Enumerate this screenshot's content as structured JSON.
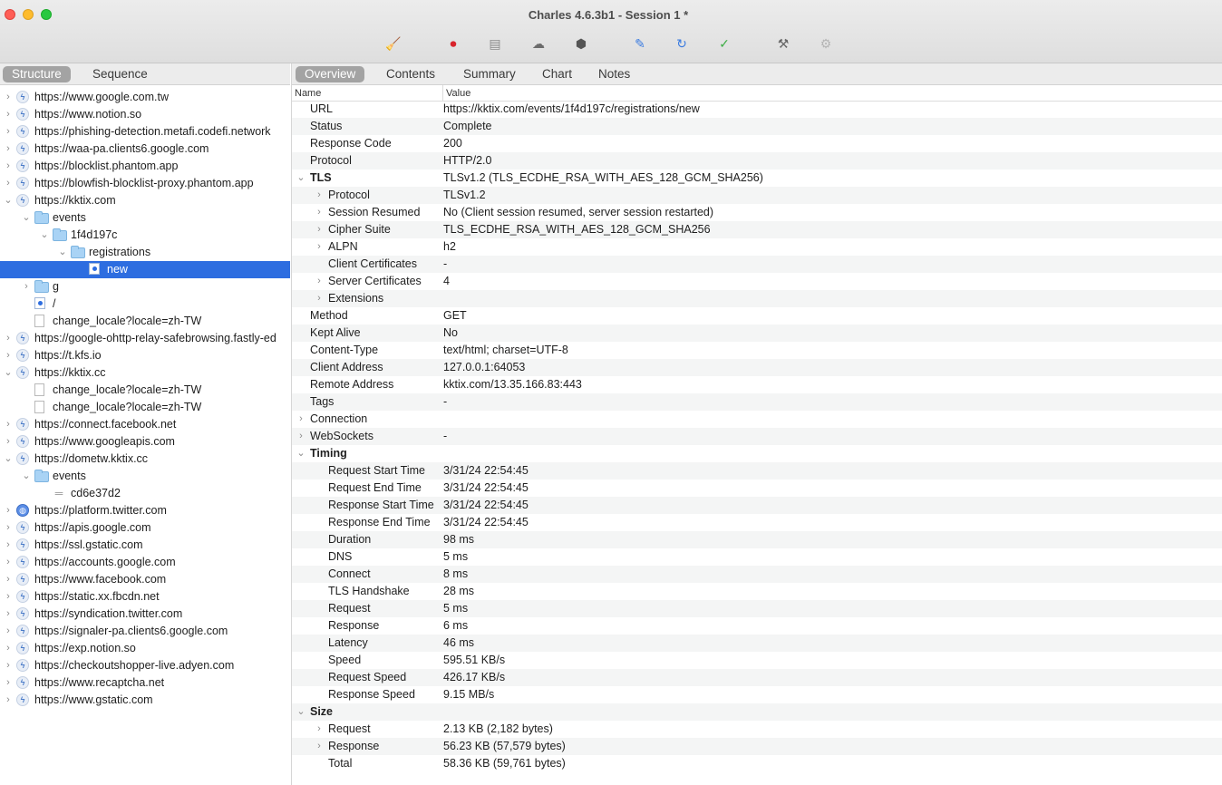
{
  "window": {
    "title": "Charles 4.6.3b1 - Session 1 *"
  },
  "toolbar": [
    {
      "name": "broom-icon",
      "glyph": "🧹"
    },
    {
      "name": "record-icon",
      "glyph": "⏺"
    },
    {
      "name": "throttle-icon",
      "glyph": "▤"
    },
    {
      "name": "cloud-icon",
      "glyph": "☁"
    },
    {
      "name": "stop-icon",
      "glyph": "⬢"
    },
    {
      "name": "pen-icon",
      "glyph": "✎"
    },
    {
      "name": "refresh-icon",
      "glyph": "↻"
    },
    {
      "name": "check-icon",
      "glyph": "✓"
    },
    {
      "name": "tools-icon",
      "glyph": "⚒"
    },
    {
      "name": "settings-icon",
      "glyph": "⚙"
    }
  ],
  "left_tabs": [
    "Structure",
    "Sequence"
  ],
  "right_tabs": [
    "Overview",
    "Contents",
    "Summary",
    "Chart",
    "Notes"
  ],
  "tree": [
    {
      "label": "https://www.google.com.tw",
      "chev": "›",
      "icon": "bolt",
      "indent": 0
    },
    {
      "label": "https://www.notion.so",
      "chev": "›",
      "icon": "bolt",
      "indent": 0
    },
    {
      "label": "https://phishing-detection.metafi.codefi.network",
      "chev": "›",
      "icon": "bolt",
      "indent": 0
    },
    {
      "label": "https://waa-pa.clients6.google.com",
      "chev": "›",
      "icon": "bolt",
      "indent": 0
    },
    {
      "label": "https://blocklist.phantom.app",
      "chev": "›",
      "icon": "bolt",
      "indent": 0
    },
    {
      "label": "https://blowfish-blocklist-proxy.phantom.app",
      "chev": "›",
      "icon": "bolt",
      "indent": 0
    },
    {
      "label": "https://kktix.com",
      "chev": "⌄",
      "icon": "bolt",
      "indent": 0
    },
    {
      "label": "events",
      "chev": "⌄",
      "icon": "folder",
      "indent": 1
    },
    {
      "label": "1f4d197c",
      "chev": "⌄",
      "icon": "folder",
      "indent": 2
    },
    {
      "label": "registrations",
      "chev": "⌄",
      "icon": "folder",
      "indent": 3
    },
    {
      "label": "new",
      "chev": "",
      "icon": "page",
      "indent": 4,
      "selected": true
    },
    {
      "label": "g",
      "chev": "›",
      "icon": "folder",
      "indent": 1
    },
    {
      "label": "/",
      "chev": "",
      "icon": "page",
      "indent": 1
    },
    {
      "label": "change_locale?locale=zh-TW",
      "chev": "",
      "icon": "doc",
      "indent": 1
    },
    {
      "label": "https://google-ohttp-relay-safebrowsing.fastly-ed",
      "chev": "›",
      "icon": "bolt",
      "indent": 0
    },
    {
      "label": "https://t.kfs.io",
      "chev": "›",
      "icon": "bolt",
      "indent": 0
    },
    {
      "label": "https://kktix.cc",
      "chev": "⌄",
      "icon": "bolt",
      "indent": 0
    },
    {
      "label": "change_locale?locale=zh-TW",
      "chev": "",
      "icon": "doc",
      "indent": 1
    },
    {
      "label": "change_locale?locale=zh-TW",
      "chev": "",
      "icon": "doc",
      "indent": 1
    },
    {
      "label": "https://connect.facebook.net",
      "chev": "›",
      "icon": "bolt",
      "indent": 0
    },
    {
      "label": "https://www.googleapis.com",
      "chev": "›",
      "icon": "bolt",
      "indent": 0
    },
    {
      "label": "https://dometw.kktix.cc",
      "chev": "⌄",
      "icon": "bolt",
      "indent": 0
    },
    {
      "label": "events",
      "chev": "⌄",
      "icon": "folder",
      "indent": 1
    },
    {
      "label": "cd6e37d2",
      "chev": "",
      "icon": "eq",
      "indent": 2
    },
    {
      "label": "https://platform.twitter.com",
      "chev": "›",
      "icon": "globe",
      "indent": 0
    },
    {
      "label": "https://apis.google.com",
      "chev": "›",
      "icon": "bolt",
      "indent": 0
    },
    {
      "label": "https://ssl.gstatic.com",
      "chev": "›",
      "icon": "bolt",
      "indent": 0
    },
    {
      "label": "https://accounts.google.com",
      "chev": "›",
      "icon": "bolt",
      "indent": 0
    },
    {
      "label": "https://www.facebook.com",
      "chev": "›",
      "icon": "bolt",
      "indent": 0
    },
    {
      "label": "https://static.xx.fbcdn.net",
      "chev": "›",
      "icon": "bolt",
      "indent": 0
    },
    {
      "label": "https://syndication.twitter.com",
      "chev": "›",
      "icon": "bolt",
      "indent": 0
    },
    {
      "label": "https://signaler-pa.clients6.google.com",
      "chev": "›",
      "icon": "bolt",
      "indent": 0
    },
    {
      "label": "https://exp.notion.so",
      "chev": "›",
      "icon": "bolt",
      "indent": 0
    },
    {
      "label": "https://checkoutshopper-live.adyen.com",
      "chev": "›",
      "icon": "bolt",
      "indent": 0
    },
    {
      "label": "https://www.recaptcha.net",
      "chev": "›",
      "icon": "bolt",
      "indent": 0
    },
    {
      "label": "https://www.gstatic.com",
      "chev": "›",
      "icon": "bolt",
      "indent": 0
    }
  ],
  "overview": {
    "col_name": "Name",
    "col_value": "Value",
    "rows": [
      {
        "name": "URL",
        "value": "https://kktix.com/events/1f4d197c/registrations/new",
        "level": 0,
        "chev": ""
      },
      {
        "name": "Status",
        "value": "Complete",
        "level": 0,
        "chev": ""
      },
      {
        "name": "Response Code",
        "value": "200",
        "level": 0,
        "chev": ""
      },
      {
        "name": "Protocol",
        "value": "HTTP/2.0",
        "level": 0,
        "chev": ""
      },
      {
        "name": "TLS",
        "value": "TLSv1.2 (TLS_ECDHE_RSA_WITH_AES_128_GCM_SHA256)",
        "level": 0,
        "chev": "⌄",
        "bold": true
      },
      {
        "name": "Protocol",
        "value": "TLSv1.2",
        "level": 1,
        "chev": "›"
      },
      {
        "name": "Session Resumed",
        "value": "No (Client session resumed, server session restarted)",
        "level": 1,
        "chev": "›"
      },
      {
        "name": "Cipher Suite",
        "value": "TLS_ECDHE_RSA_WITH_AES_128_GCM_SHA256",
        "level": 1,
        "chev": "›"
      },
      {
        "name": "ALPN",
        "value": "h2",
        "level": 1,
        "chev": "›"
      },
      {
        "name": "Client Certificates",
        "value": "-",
        "level": 1,
        "chev": ""
      },
      {
        "name": "Server Certificates",
        "value": "4",
        "level": 1,
        "chev": "›"
      },
      {
        "name": "Extensions",
        "value": "",
        "level": 1,
        "chev": "›"
      },
      {
        "name": "Method",
        "value": "GET",
        "level": 0,
        "chev": ""
      },
      {
        "name": "Kept Alive",
        "value": "No",
        "level": 0,
        "chev": ""
      },
      {
        "name": "Content-Type",
        "value": "text/html; charset=UTF-8",
        "level": 0,
        "chev": ""
      },
      {
        "name": "Client Address",
        "value": "127.0.0.1:64053",
        "level": 0,
        "chev": ""
      },
      {
        "name": "Remote Address",
        "value": "kktix.com/13.35.166.83:443",
        "level": 0,
        "chev": ""
      },
      {
        "name": "Tags",
        "value": "-",
        "level": 0,
        "chev": ""
      },
      {
        "name": "Connection",
        "value": "",
        "level": 0,
        "chev": "›"
      },
      {
        "name": "WebSockets",
        "value": "-",
        "level": 0,
        "chev": "›"
      },
      {
        "name": "Timing",
        "value": "",
        "level": 0,
        "chev": "⌄",
        "bold": true
      },
      {
        "name": "Request Start Time",
        "value": "3/31/24 22:54:45",
        "level": 1,
        "chev": ""
      },
      {
        "name": "Request End Time",
        "value": "3/31/24 22:54:45",
        "level": 1,
        "chev": ""
      },
      {
        "name": "Response Start Time",
        "value": "3/31/24 22:54:45",
        "level": 1,
        "chev": ""
      },
      {
        "name": "Response End Time",
        "value": "3/31/24 22:54:45",
        "level": 1,
        "chev": ""
      },
      {
        "name": "Duration",
        "value": "98 ms",
        "level": 1,
        "chev": ""
      },
      {
        "name": "DNS",
        "value": "5 ms",
        "level": 1,
        "chev": ""
      },
      {
        "name": "Connect",
        "value": "8 ms",
        "level": 1,
        "chev": ""
      },
      {
        "name": "TLS Handshake",
        "value": "28 ms",
        "level": 1,
        "chev": ""
      },
      {
        "name": "Request",
        "value": "5 ms",
        "level": 1,
        "chev": ""
      },
      {
        "name": "Response",
        "value": "6 ms",
        "level": 1,
        "chev": ""
      },
      {
        "name": "Latency",
        "value": "46 ms",
        "level": 1,
        "chev": ""
      },
      {
        "name": "Speed",
        "value": "595.51 KB/s",
        "level": 1,
        "chev": ""
      },
      {
        "name": "Request Speed",
        "value": "426.17 KB/s",
        "level": 1,
        "chev": ""
      },
      {
        "name": "Response Speed",
        "value": "9.15 MB/s",
        "level": 1,
        "chev": ""
      },
      {
        "name": "Size",
        "value": "",
        "level": 0,
        "chev": "⌄",
        "bold": true
      },
      {
        "name": "Request",
        "value": "2.13 KB (2,182 bytes)",
        "level": 1,
        "chev": "›"
      },
      {
        "name": "Response",
        "value": "56.23 KB (57,579 bytes)",
        "level": 1,
        "chev": "›"
      },
      {
        "name": "Total",
        "value": "58.36 KB (59,761 bytes)",
        "level": 1,
        "chev": ""
      }
    ]
  },
  "colors": {
    "selection": "#2d6de0",
    "tab_active": "#a3a3a3"
  }
}
